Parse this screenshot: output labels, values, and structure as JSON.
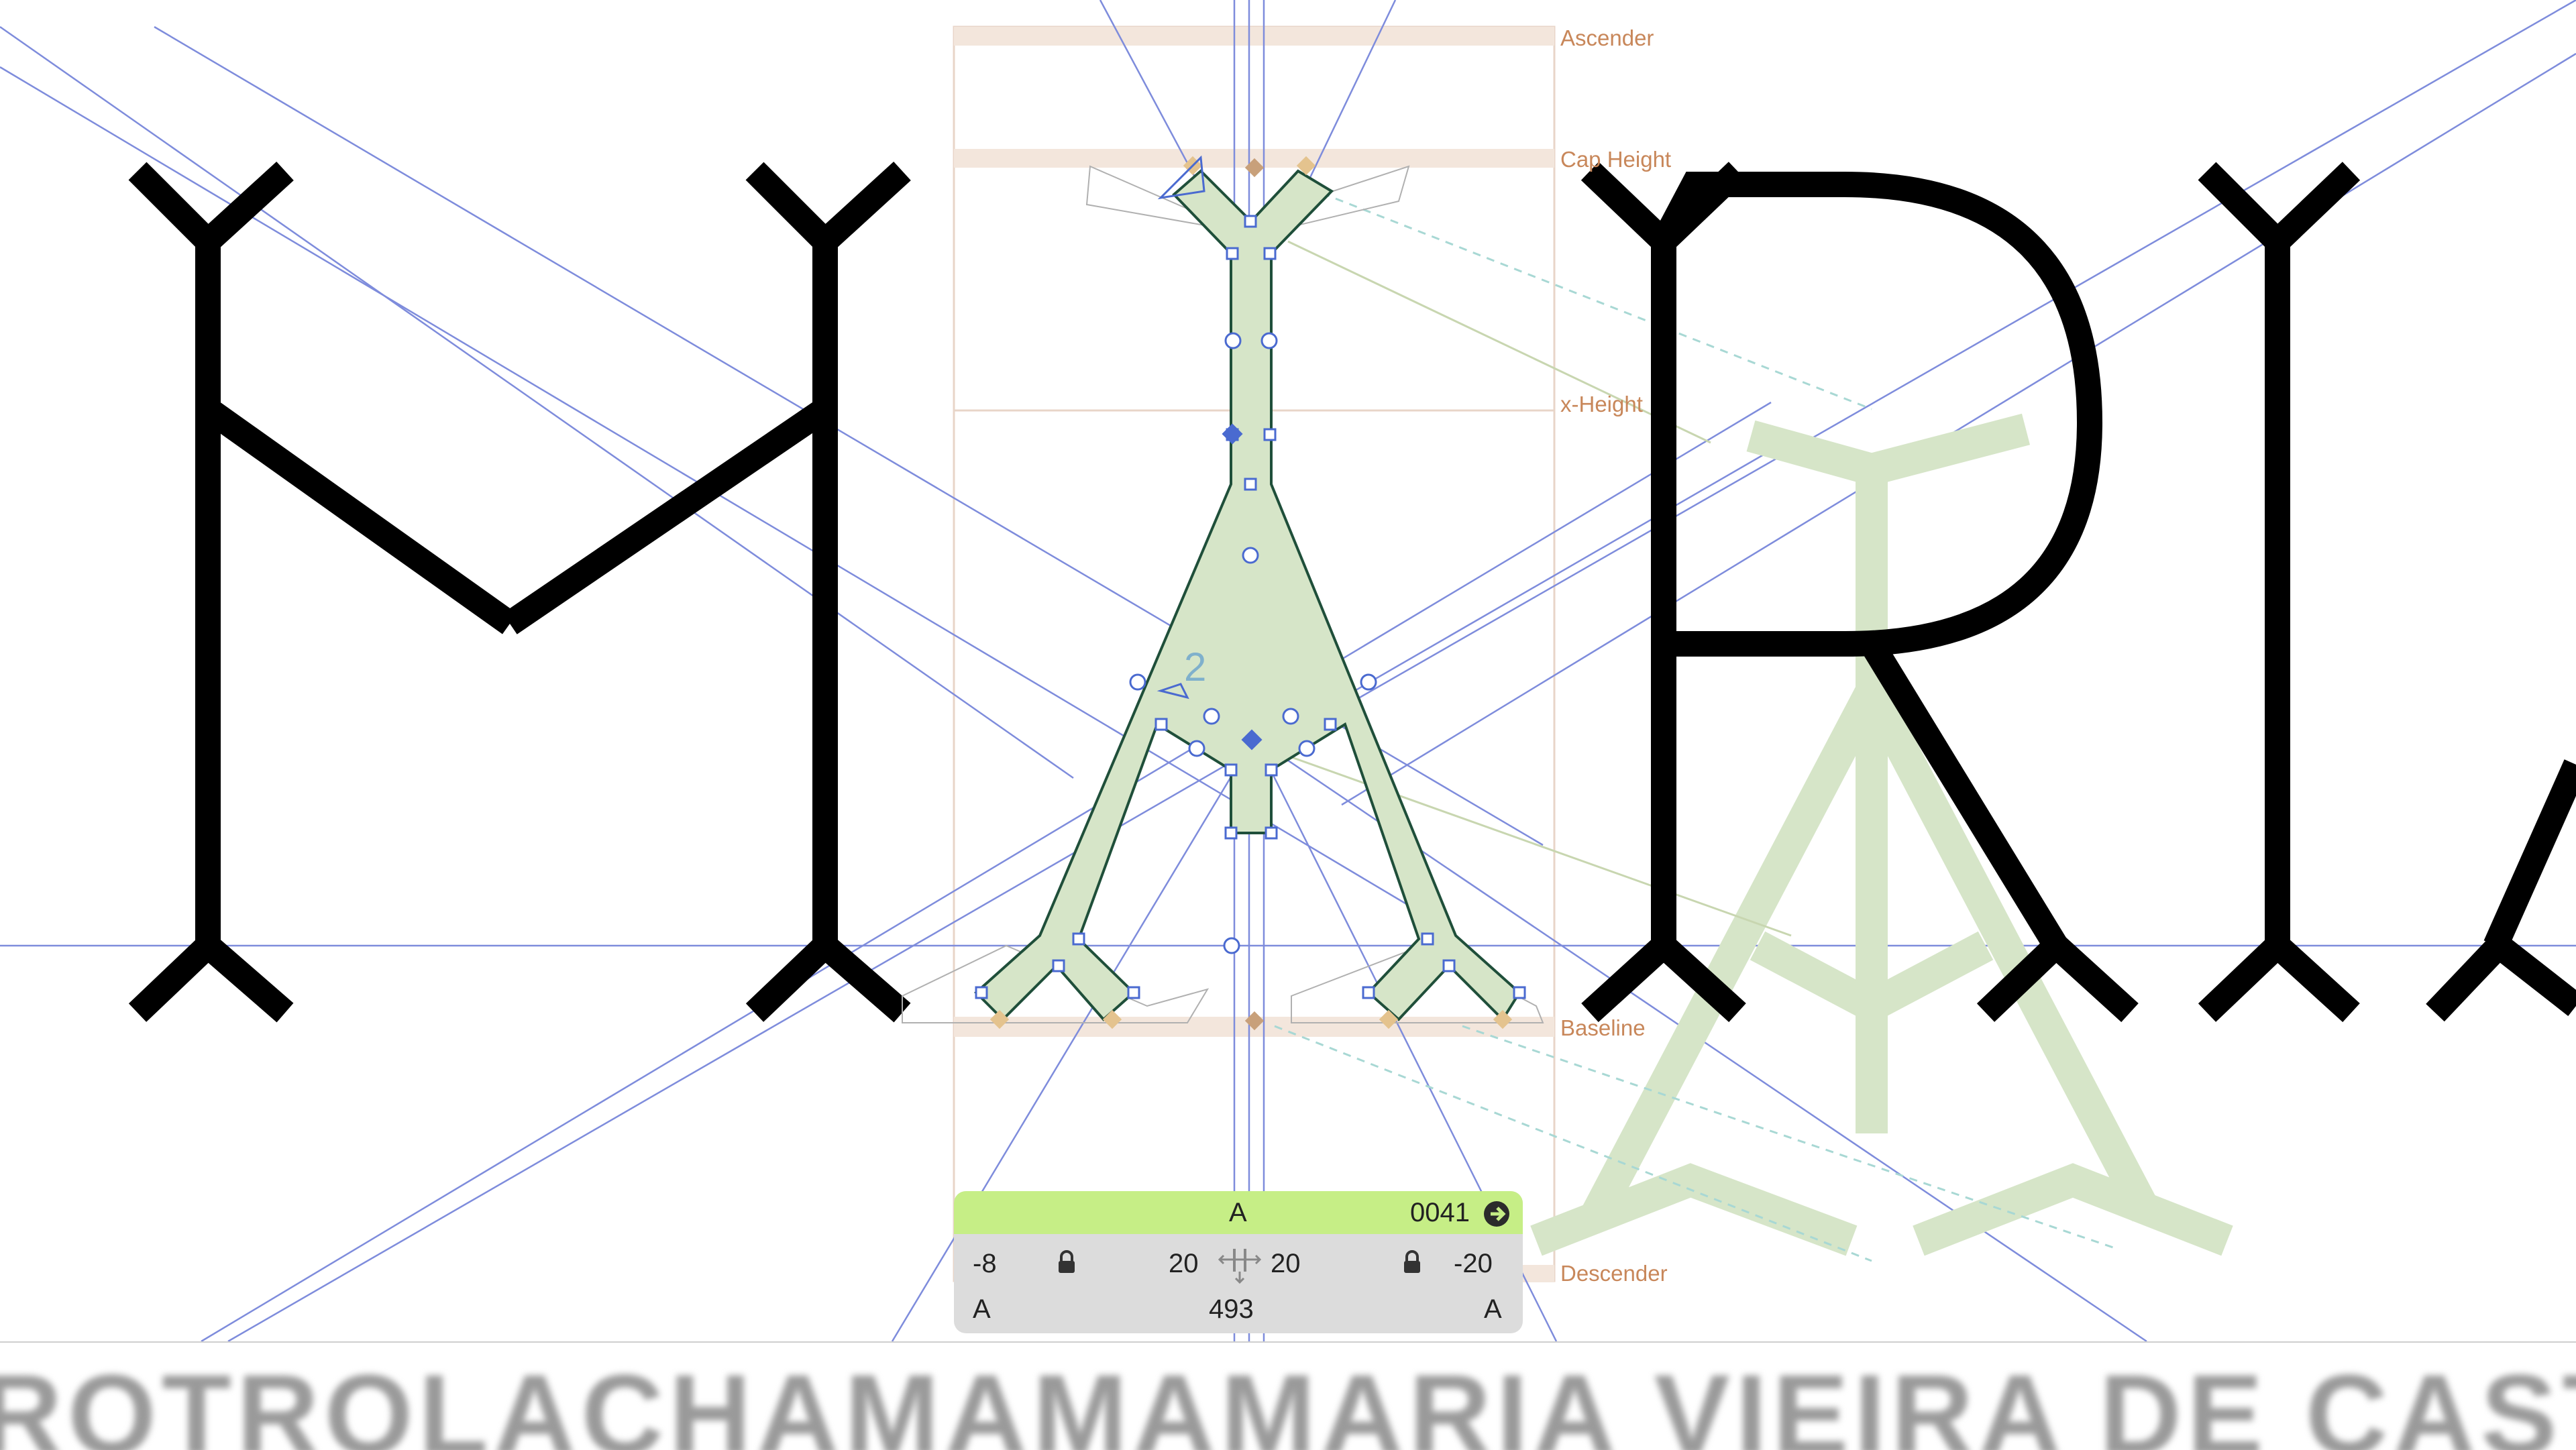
{
  "metrics": {
    "ascender": "Ascender",
    "cap_height": "Cap Height",
    "x_height": "x-Height",
    "baseline": "Baseline",
    "descender": "Descender"
  },
  "glyph_text": "MARIA",
  "node_label": "2",
  "glyph_info": {
    "name": "A",
    "unicode": "0041",
    "lsb": "-8",
    "lsb_kern": "20",
    "rsb_kern": "20",
    "rsb": "-20",
    "left_group": "A",
    "width": "493",
    "right_group": "A"
  },
  "preview_text": "ROTROLACHAMAMAMARIA VIEIRA DE CASTRO",
  "colors": {
    "accent_green": "#c6ee86",
    "glyph_fill": "#d6e5c8",
    "metric_line": "#c8875a",
    "guide_blue": "#6a7ad8",
    "ink": "#000000"
  }
}
